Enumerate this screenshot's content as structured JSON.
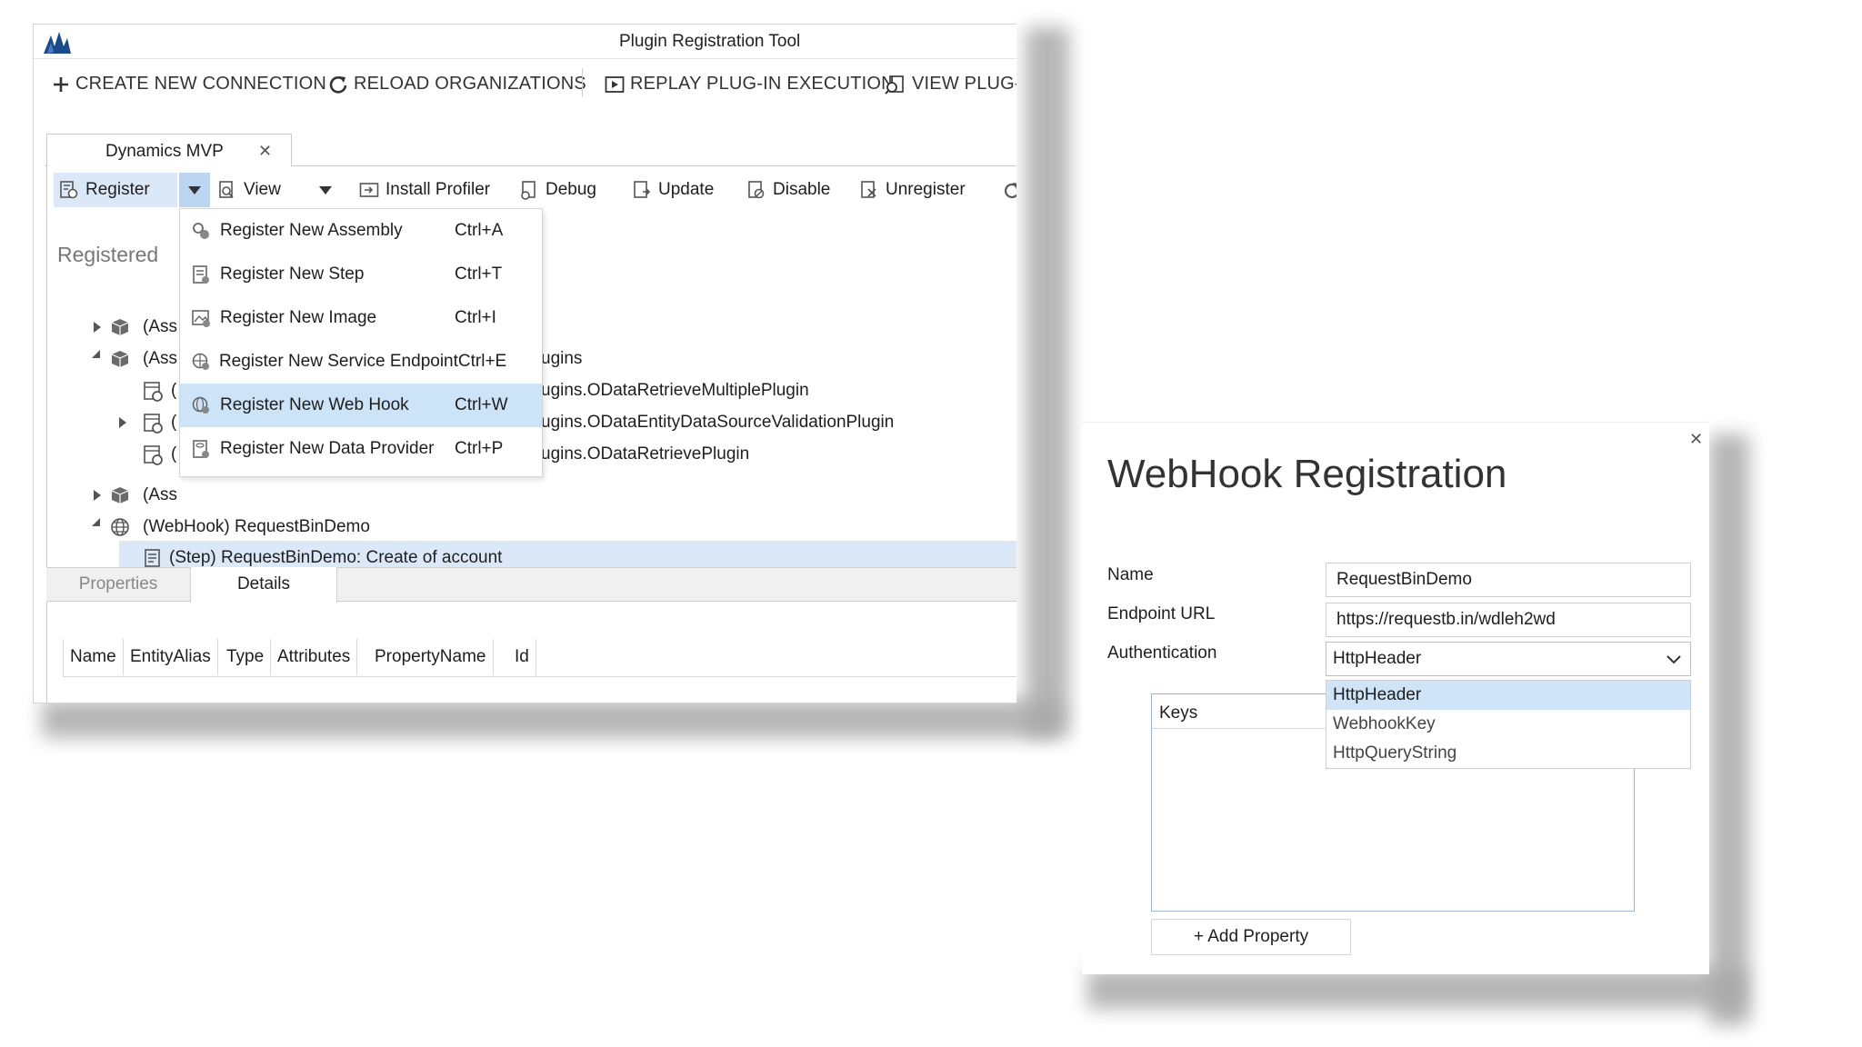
{
  "plugin_tool": {
    "title": "Plugin Registration Tool",
    "toolbar": {
      "create_connection": "CREATE NEW CONNECTION",
      "reload_orgs": "RELOAD ORGANIZATIONS",
      "replay": "REPLAY PLUG-IN EXECUTION",
      "view_plugin": "VIEW PLUG-I"
    },
    "org_tab": {
      "label": "Dynamics MVP",
      "close": "✕"
    },
    "subtoolbar": {
      "register": "Register",
      "view": "View",
      "install_profiler": "Install Profiler",
      "debug": "Debug",
      "update": "Update",
      "disable": "Disable",
      "unregister": "Unregister"
    },
    "registered_label": "Registered",
    "tree": {
      "row1": "(Ass",
      "row2": "(Ass",
      "row2_suffix": "ugins",
      "row3_prefix": "(",
      "row3_suffix": "ugins.ODataRetrieveMultiplePlugin",
      "row4_prefix": "(",
      "row4_suffix": "ugins.ODataEntityDataSourceValidationPlugin",
      "row5_prefix": "(",
      "row5_suffix": "ugins.ODataRetrievePlugin",
      "row6": "(Ass",
      "webhook": "(WebHook) RequestBinDemo",
      "step": "(Step) RequestBinDemo: Create of account"
    },
    "register_menu": [
      {
        "label": "Register New Assembly",
        "shortcut": "Ctrl+A",
        "icon": "assembly-icon"
      },
      {
        "label": "Register New Step",
        "shortcut": "Ctrl+T",
        "icon": "step-icon"
      },
      {
        "label": "Register New Image",
        "shortcut": "Ctrl+I",
        "icon": "image-icon"
      },
      {
        "label": "Register New Service Endpoint",
        "shortcut": "Ctrl+E",
        "icon": "service-endpoint-icon"
      },
      {
        "label": "Register New Web Hook",
        "shortcut": "Ctrl+W",
        "icon": "web-hook-icon"
      },
      {
        "label": "Register New Data Provider",
        "shortcut": "Ctrl+P",
        "icon": "data-provider-icon"
      }
    ],
    "bottom_tabs": {
      "properties": "Properties",
      "details": "Details"
    },
    "details_columns": [
      "Name",
      "EntityAlias",
      "Type",
      "Attributes",
      "PropertyName",
      "Id"
    ]
  },
  "webhook_dialog": {
    "close": "✕",
    "title": "WebHook Registration",
    "name_label": "Name",
    "name_value": "RequestBinDemo",
    "endpoint_label": "Endpoint URL",
    "endpoint_value": "https://requestb.in/wdleh2wd",
    "auth_label": "Authentication",
    "auth_value": "HttpHeader",
    "auth_options": [
      "HttpHeader",
      "WebhookKey",
      "HttpQueryString"
    ],
    "keys_header": "Keys",
    "add_property": "+ Add Property"
  },
  "colors": {
    "selection": "#dbe8f8",
    "menu_highlight": "#cde3f7",
    "dropdown_highlight": "#cfe4f6",
    "window_border": "#c9c9c9"
  }
}
